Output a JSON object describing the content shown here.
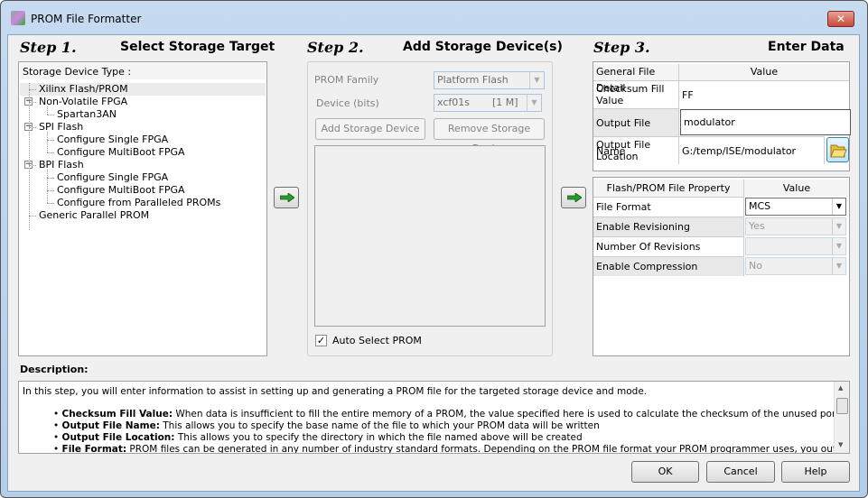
{
  "window": {
    "title": "PROM File Formatter",
    "close_label": "✕"
  },
  "step1": {
    "step": "Step 1.",
    "title": "Select Storage Target",
    "tree_header": "Storage Device Type :",
    "items": [
      {
        "label": "Xilinx Flash/PROM",
        "level": 0,
        "selected": true
      },
      {
        "label": "Non-Volatile FPGA",
        "level": 0,
        "expanded": true
      },
      {
        "label": "Spartan3AN",
        "level": 1
      },
      {
        "label": "SPI Flash",
        "level": 0,
        "expanded": true
      },
      {
        "label": "Configure Single FPGA",
        "level": 1
      },
      {
        "label": "Configure MultiBoot FPGA",
        "level": 1
      },
      {
        "label": "BPI Flash",
        "level": 0,
        "expanded": true
      },
      {
        "label": "Configure Single FPGA",
        "level": 1
      },
      {
        "label": "Configure MultiBoot FPGA",
        "level": 1
      },
      {
        "label": "Configure from Paralleled PROMs",
        "level": 1
      },
      {
        "label": "Generic Parallel PROM",
        "level": 0
      }
    ]
  },
  "step2": {
    "step": "Step 2.",
    "title": "Add Storage Device(s)",
    "prom_family_label": "PROM Family",
    "prom_family_value": "Platform Flash",
    "device_label": "Device (bits)",
    "device_value": "xcf01s",
    "device_size": "[1 M]",
    "add_button": "Add Storage Device",
    "remove_button": "Remove Storage Device",
    "auto_select_label": "Auto Select PROM",
    "auto_select_checked": true
  },
  "step3": {
    "step": "Step 3.",
    "title": "Enter Data",
    "general": {
      "header_col1": "General File Detail",
      "header_col2": "Value",
      "rows": [
        {
          "label": "Checksum Fill Value",
          "value": "FF"
        },
        {
          "label": "Output File Name",
          "value": "modulator"
        },
        {
          "label": "Output File Location",
          "value": "G:/temp/ISE/modulator"
        }
      ]
    },
    "property": {
      "header_col1": "Flash/PROM File Property",
      "header_col2": "Value",
      "rows": [
        {
          "label": "File Format",
          "value": "MCS",
          "enabled": true
        },
        {
          "label": "Enable Revisioning",
          "value": "Yes",
          "enabled": false
        },
        {
          "label": "Number Of Revisions",
          "value": "",
          "enabled": false
        },
        {
          "label": "Enable Compression",
          "value": "No",
          "enabled": false
        }
      ]
    }
  },
  "description": {
    "label": "Description:",
    "intro": "In this step, you will enter information to assist in setting up and generating a PROM file for the targeted storage device and mode.",
    "bullets": [
      {
        "term": "Checksum Fill Value:",
        "text": " When data is insufficient to fill the entire memory of a PROM, the value specified here is used to calculate the checksum of the unused portions."
      },
      {
        "term": "Output File Name:",
        "text": " This allows you to specify the base name of the file to which your PROM data will be written"
      },
      {
        "term": "Output File Location:",
        "text": " This allows you to specify the directory in which the file named above will be created"
      },
      {
        "term": "File Format:",
        "text": " PROM files can be generated in any number of industry standard formats. Depending on the PROM file format your PROM programmer uses, you output a MCS"
      }
    ]
  },
  "buttons": {
    "ok": "OK",
    "cancel": "Cancel",
    "help": "Help"
  },
  "icons": {
    "arrow": "green-right-arrow",
    "browse": "folder-icon"
  }
}
